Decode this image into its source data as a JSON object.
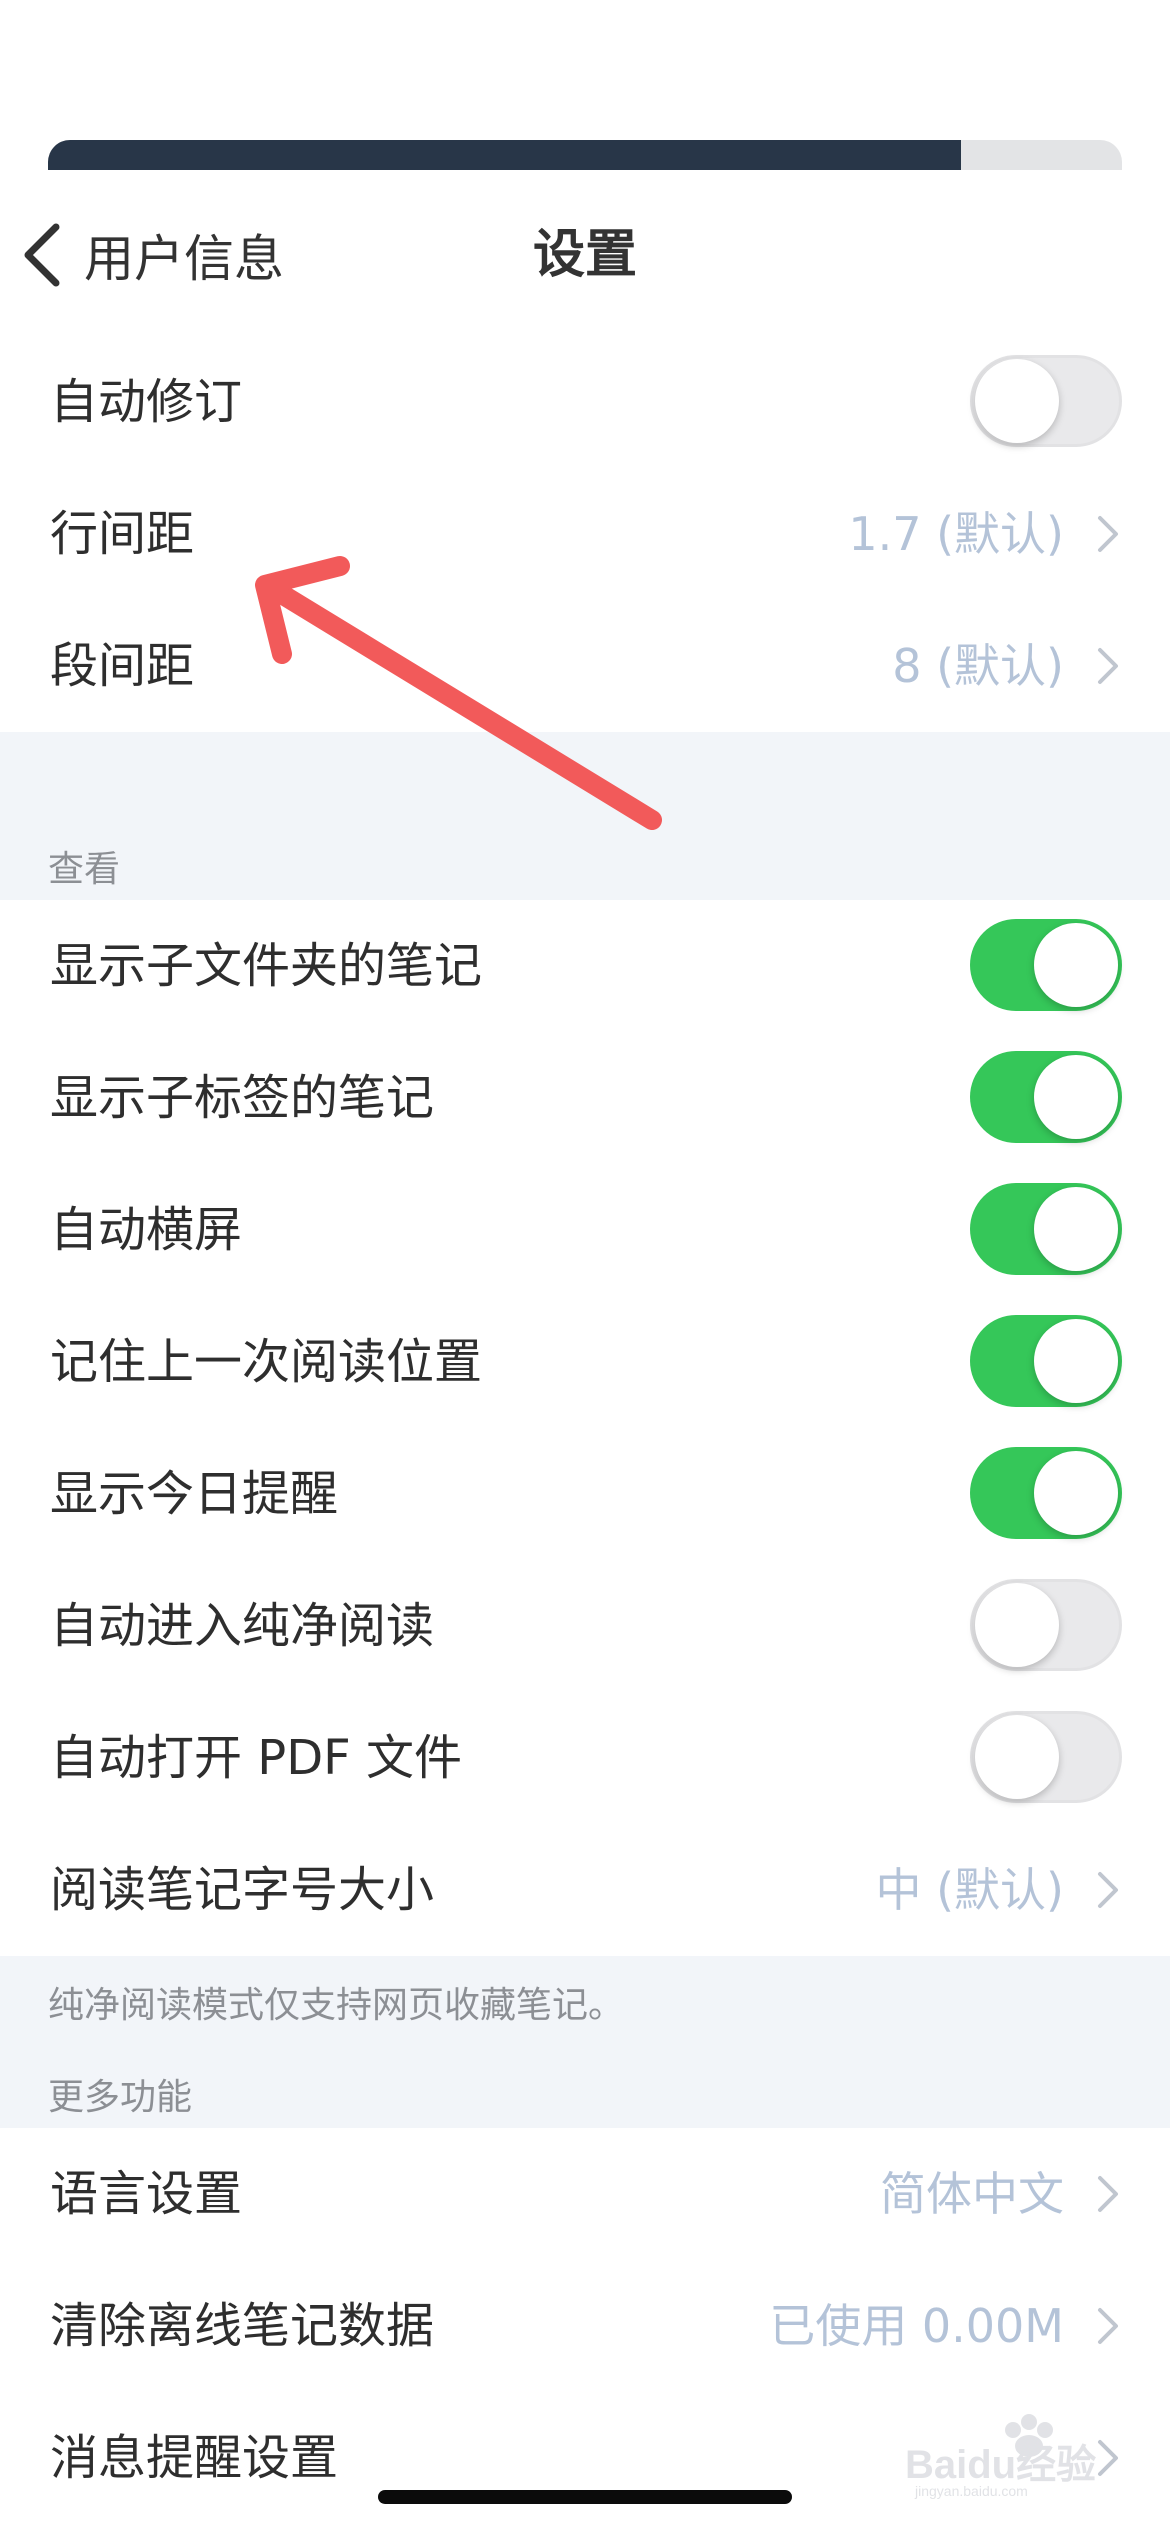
{
  "progress": {
    "fraction": 0.85
  },
  "navbar": {
    "back_label": "用户信息",
    "title": "设置"
  },
  "rows_top": [
    {
      "label": "自动修订",
      "toggle": "off"
    },
    {
      "label": "行间距",
      "value": "1.7 (默认)"
    },
    {
      "label": "段间距",
      "value": "8 (默认)"
    }
  ],
  "section_view": {
    "header": "查看",
    "rows": [
      {
        "label": "显示子文件夹的笔记",
        "toggle": "on"
      },
      {
        "label": "显示子标签的笔记",
        "toggle": "on"
      },
      {
        "label": "自动横屏",
        "toggle": "on"
      },
      {
        "label": "记住上一次阅读位置",
        "toggle": "on"
      },
      {
        "label": "显示今日提醒",
        "toggle": "on"
      },
      {
        "label": "自动进入纯净阅读",
        "toggle": "off"
      },
      {
        "label": "自动打开 PDF 文件",
        "toggle": "off"
      },
      {
        "label": "阅读笔记字号大小",
        "value": "中 (默认)"
      }
    ],
    "footnote": "纯净阅读模式仅支持网页收藏笔记。"
  },
  "section_more": {
    "header": "更多功能",
    "rows": [
      {
        "label": "语言设置",
        "value": "简体中文"
      },
      {
        "label": "清除离线笔记数据",
        "value": "已使用 0.00M"
      },
      {
        "label": "消息提醒设置"
      }
    ]
  },
  "annotation": {
    "arrow_color": "#f25a5a"
  },
  "watermark": {
    "text": "Baidu经验",
    "subtext": "jingyan.baidu.com"
  },
  "colors": {
    "toggle_on": "#35c759",
    "value_text": "#b4c3d8",
    "section_bg": "#f2f5f9",
    "progress_fill": "#283648"
  }
}
